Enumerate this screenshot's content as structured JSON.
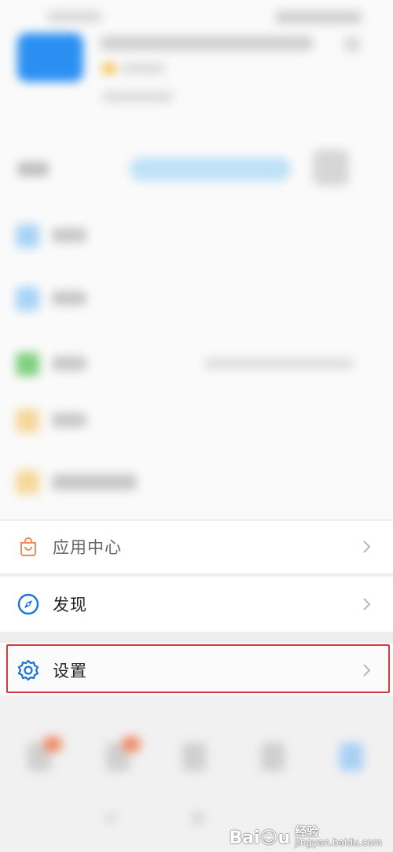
{
  "menu": {
    "app_center_label": "应用中心",
    "discover_label": "发现",
    "settings_label": "设置"
  },
  "icons": {
    "app_center": "shopping-bag-icon",
    "discover": "compass-icon",
    "settings": "gear-icon",
    "chevron": "chevron-right-icon"
  },
  "colors": {
    "highlight_border": "#d63a3a",
    "accent_blue": "#1a73d9",
    "app_center_orange": "#ee8a5c"
  },
  "watermark": {
    "logo": "Bai☺u",
    "chinese": "经验",
    "url": "jingyan.baidu.com"
  }
}
